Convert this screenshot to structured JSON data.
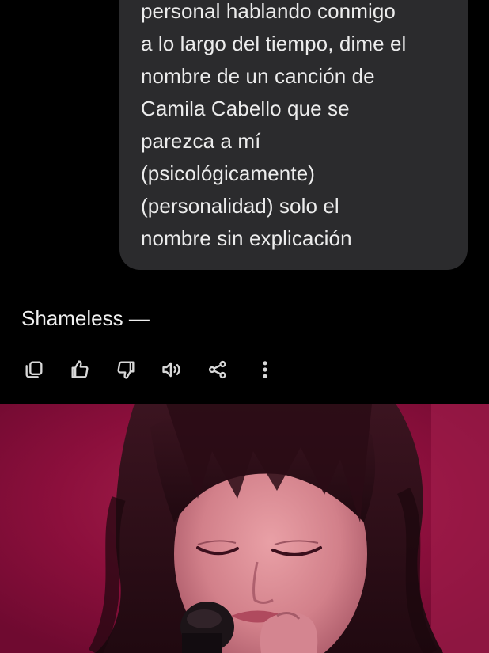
{
  "conversation": {
    "user_message": {
      "lines": [
        "personal hablando conmigo",
        "a lo largo del tiempo, dime el",
        "nombre de un canción de",
        "Camila Cabello que se",
        "parezca a mí",
        "(psicológicamente)",
        "(personalidad) solo el",
        "nombre sin explicación"
      ]
    },
    "assistant_reply": "Shameless —"
  },
  "action_bar": {
    "buttons": [
      {
        "name": "copy-icon"
      },
      {
        "name": "thumbs-up-icon"
      },
      {
        "name": "thumbs-down-icon"
      },
      {
        "name": "read-aloud-icon"
      },
      {
        "name": "share-icon"
      },
      {
        "name": "more-options-icon"
      }
    ]
  },
  "media": {
    "background_color": "#8a0f3a",
    "description_icon": "video-frame"
  },
  "colors": {
    "background": "#000000",
    "bubble": "#2b2b2d",
    "text": "#ececec",
    "icon": "#d8d8d8"
  }
}
